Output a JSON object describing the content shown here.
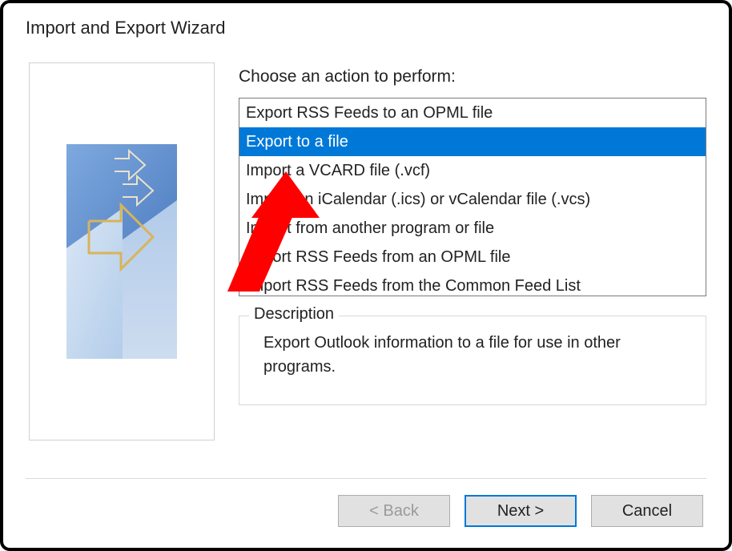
{
  "window": {
    "title": "Import and Export Wizard"
  },
  "prompt": "Choose an action to perform:",
  "actions": [
    {
      "label": "Export RSS Feeds to an OPML file",
      "selected": false
    },
    {
      "label": "Export to a file",
      "selected": true
    },
    {
      "label": "Import a VCARD file (.vcf)",
      "selected": false
    },
    {
      "label": "Import an iCalendar (.ics) or vCalendar file (.vcs)",
      "selected": false
    },
    {
      "label": "Import from another program or file",
      "selected": false
    },
    {
      "label": "Import RSS Feeds from an OPML file",
      "selected": false
    },
    {
      "label": "Import RSS Feeds from the Common Feed List",
      "selected": false
    }
  ],
  "description": {
    "legend": "Description",
    "text": "Export Outlook information to a file for use in other programs."
  },
  "buttons": {
    "back": "< Back",
    "next": "Next >",
    "cancel": "Cancel"
  },
  "annotation": {
    "color": "#ff0000"
  }
}
